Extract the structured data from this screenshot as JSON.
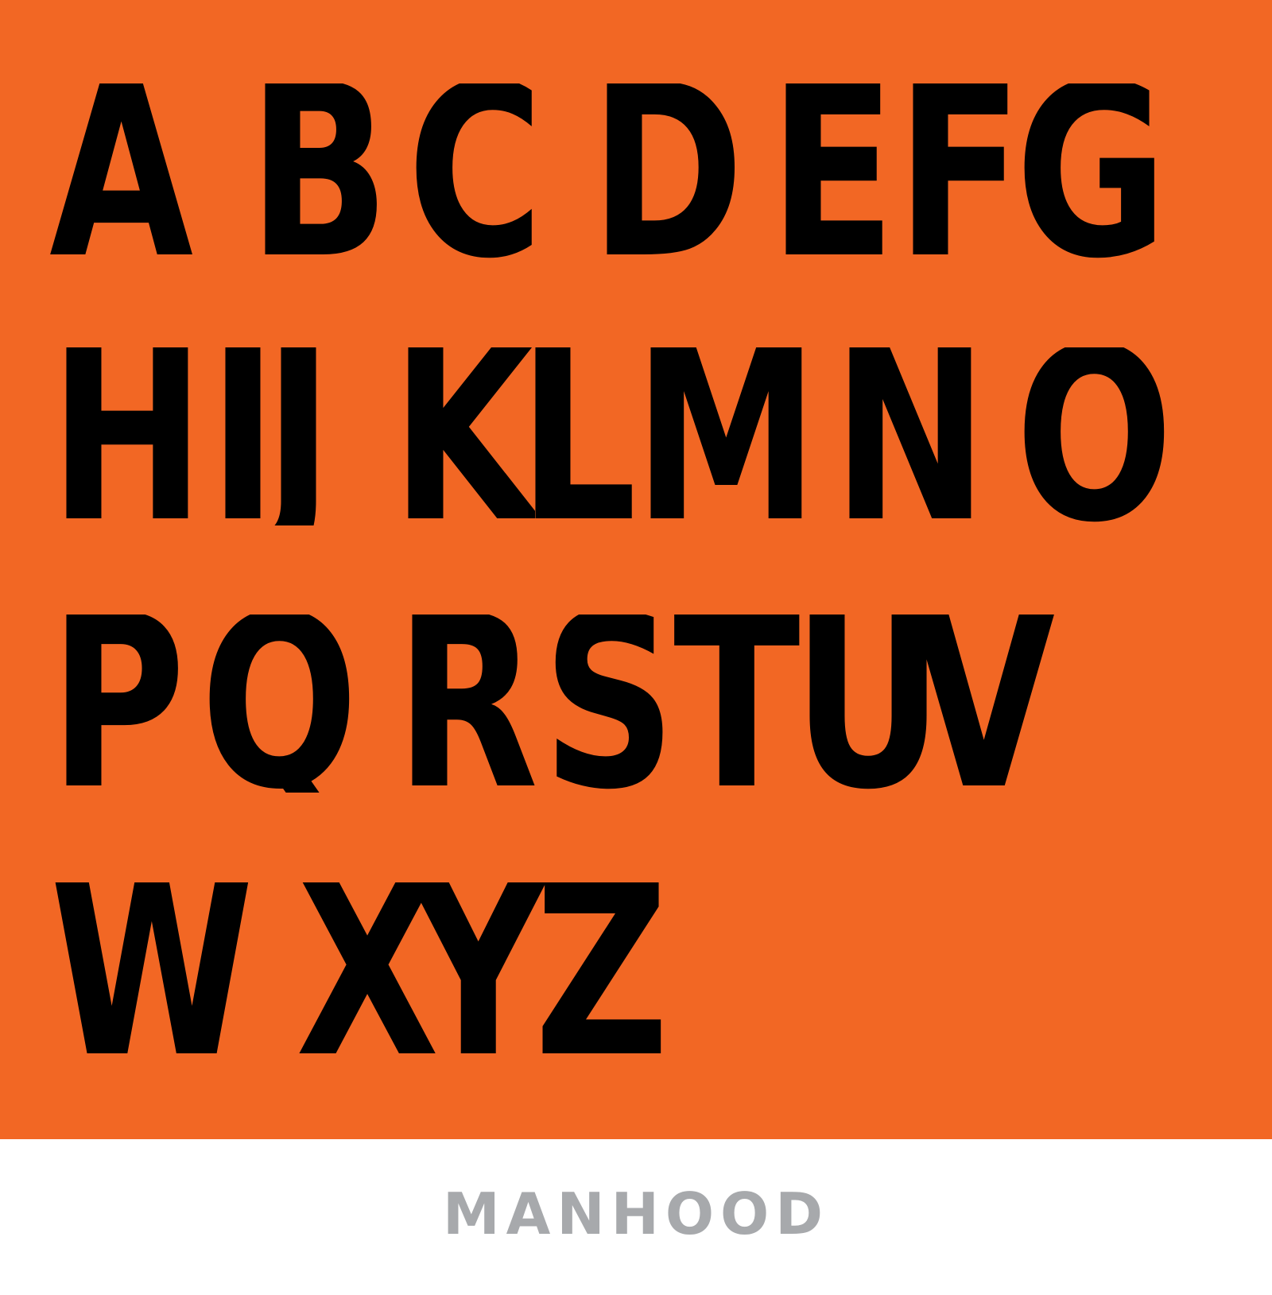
{
  "specimen": {
    "background_color": "#f26724",
    "glyph_color": "#000000",
    "rows": [
      [
        "A",
        "B",
        "C",
        "D",
        "E",
        "F",
        "G"
      ],
      [
        "H",
        "I",
        "J",
        "K",
        "L",
        "M",
        "N",
        "O"
      ],
      [
        "P",
        "Q",
        "R",
        "S",
        "T",
        "U",
        "V"
      ],
      [
        "W",
        "X",
        "Y",
        "Z"
      ]
    ]
  },
  "footer": {
    "font_name": "MANHOOD",
    "text_color": "#a7a9ac"
  }
}
